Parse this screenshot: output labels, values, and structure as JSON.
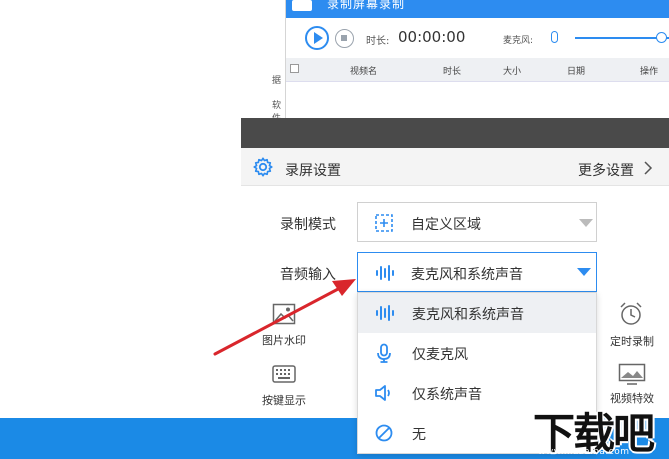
{
  "mini_app": {
    "title": "录制屏幕录制",
    "duration_label": "时长:",
    "time": "00:00:00",
    "mic_label": "麦克风:",
    "side_labels": [
      "据",
      "软件"
    ],
    "columns": [
      "视频名",
      "时长",
      "大小",
      "日期",
      "操作"
    ]
  },
  "panel": {
    "title": "录屏设置",
    "more_settings": "更多设置",
    "record_mode_label": "录制模式",
    "record_mode_value": "自定义区域",
    "audio_input_label": "音频输入",
    "audio_input_value": "麦克风和系统声音"
  },
  "features": {
    "image_watermark": "图片水印",
    "key_display": "按键显示",
    "timed_record": "定时录制",
    "video_effects": "视频特效"
  },
  "dropdown": {
    "options": [
      {
        "label": "麦克风和系统声音",
        "icon": "sound-wave-icon"
      },
      {
        "label": "仅麦克风",
        "icon": "microphone-icon"
      },
      {
        "label": "仅系统声音",
        "icon": "speaker-icon"
      },
      {
        "label": "无",
        "icon": "none-icon"
      }
    ],
    "selected_index": 0
  },
  "watermark": {
    "text": "下载吧",
    "url": "www.xiazaiba.com"
  },
  "colors": {
    "accent": "#2d8cf0",
    "bottom_bar": "#1b8ae6",
    "arrow": "#d9262c"
  }
}
